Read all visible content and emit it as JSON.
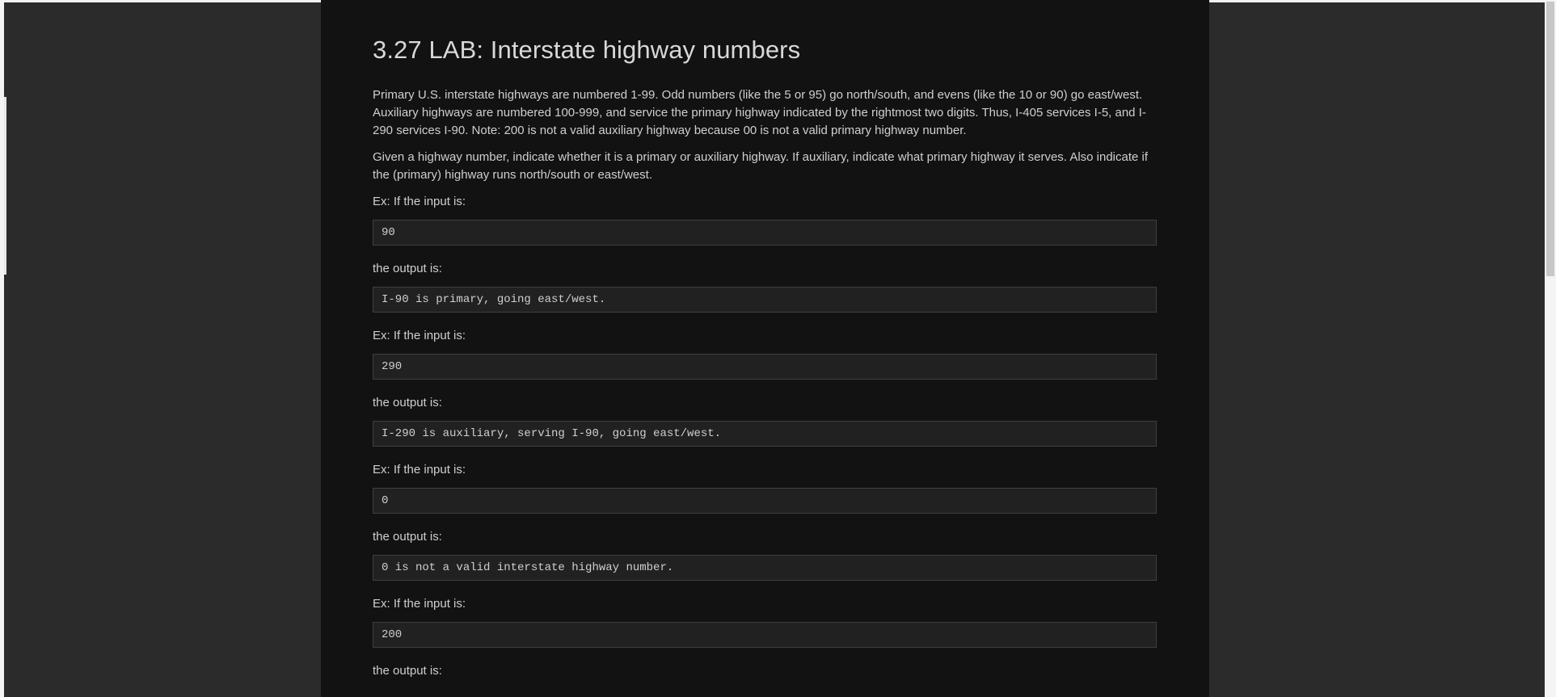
{
  "lab": {
    "title": "3.27 LAB: Interstate highway numbers",
    "paragraph_1": "Primary U.S. interstate highways are numbered 1-99. Odd numbers (like the 5 or 95) go north/south, and evens (like the 10 or 90) go east/west. Auxiliary highways are numbered 100-999, and service the primary highway indicated by the rightmost two digits. Thus, I-405 services I-5, and I-290 services I-90. Note: 200 is not a valid auxiliary highway because 00 is not a valid primary highway number.",
    "paragraph_2": "Given a highway number, indicate whether it is a primary or auxiliary highway. If auxiliary, indicate what primary highway it serves. Also indicate if the (primary) highway runs north/south or east/west.",
    "examples": [
      {
        "input_label": "Ex: If the input is:",
        "input": "90",
        "output_label": "the output is:",
        "output": "I-90 is primary, going east/west."
      },
      {
        "input_label": "Ex: If the input is:",
        "input": "290",
        "output_label": "the output is:",
        "output": "I-290 is auxiliary, serving I-90, going east/west."
      },
      {
        "input_label": "Ex: If the input is:",
        "input": "0",
        "output_label": "the output is:",
        "output": "0 is not a valid interstate highway number."
      },
      {
        "input_label": "Ex: If the input is:",
        "input": "200",
        "output_label": "the output is:"
      }
    ]
  },
  "colors": {
    "panel_background": "#121212",
    "page_background": "#2b2b2b",
    "code_background": "#212121",
    "text": "#cfcfcf"
  }
}
